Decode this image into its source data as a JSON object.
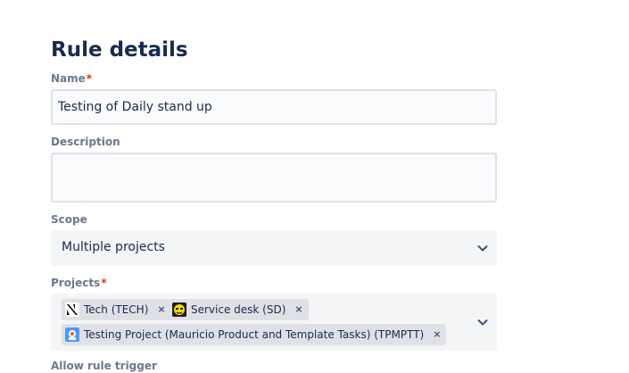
{
  "page": {
    "title": "Rule details"
  },
  "fields": {
    "name": {
      "label": "Name",
      "required_mark": "*",
      "value": "Testing of Daily stand up"
    },
    "description": {
      "label": "Description",
      "value": ""
    },
    "scope": {
      "label": "Scope",
      "value": "Multiple projects"
    },
    "projects": {
      "label": "Projects",
      "required_mark": "*",
      "tags": [
        {
          "label": "Tech (TECH)",
          "icon": "tech-project-avatar-icon",
          "remove": "×"
        },
        {
          "label": "Service desk (SD)",
          "icon": "service-desk-avatar-icon",
          "remove": "×"
        },
        {
          "label": "Testing Project (Mauricio Product and Template Tasks) (TPMPTT)",
          "icon": "testing-project-avatar-icon",
          "remove": "×"
        }
      ]
    },
    "next_partial": {
      "label": "Allow rule trigger"
    }
  },
  "icons": {
    "dropdown": "chevron-down-icon"
  },
  "colors": {
    "heading": "#172b4d",
    "label": "#6b778c",
    "required": "#de350b",
    "input_border": "#dfe1e6",
    "input_bg": "#fafbfc",
    "select_bg": "#f4f5f7",
    "tag_bg": "#dfe1e6"
  }
}
